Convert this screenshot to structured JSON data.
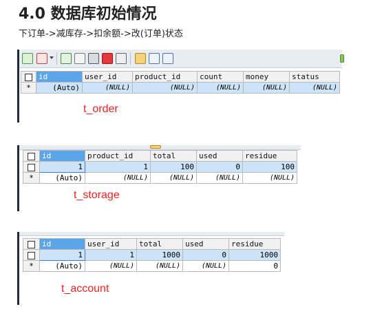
{
  "heading": "4.0 数据库初始情况",
  "description": "下订单->减库存->扣余额->改(订单)状态",
  "colors": {
    "selected_header": "#5aa6e8",
    "row_highlight": "#cde3f8",
    "label_red": "#ee2222",
    "panel_border": "#1f2a3c"
  },
  "toolbar_icons": [
    "add-record-icon",
    "delete-record-icon",
    "dropdown-icon",
    "insert-icon",
    "copy-icon",
    "save-icon",
    "trash-icon",
    "cancel-icon",
    "grid-view-icon",
    "form-view-icon",
    "text-view-icon",
    "partial-icon"
  ],
  "t_order": {
    "label": "t_order",
    "columns": [
      "id",
      "user_id",
      "product_id",
      "count",
      "money",
      "status"
    ],
    "rows": [
      {
        "indicator": "*",
        "cells": [
          "(Auto)",
          "(NULL)",
          "(NULL)",
          "(NULL)",
          "(NULL)",
          "(NULL)"
        ]
      }
    ]
  },
  "t_storage": {
    "label": "t_storage",
    "columns": [
      "id",
      "product_id",
      "total",
      "used",
      "residue"
    ],
    "rows": [
      {
        "indicator": "",
        "cells": [
          "1",
          "1",
          "100",
          "0",
          "100"
        ]
      },
      {
        "indicator": "*",
        "cells": [
          "(Auto)",
          "(NULL)",
          "(NULL)",
          "(NULL)",
          "(NULL)"
        ]
      }
    ]
  },
  "t_account": {
    "label": "t_account",
    "columns": [
      "id",
      "user_id",
      "total",
      "used",
      "residue"
    ],
    "rows": [
      {
        "indicator": "",
        "cells": [
          "1",
          "1",
          "1000",
          "0",
          "1000"
        ]
      },
      {
        "indicator": "*",
        "cells": [
          "(Auto)",
          "(NULL)",
          "(NULL)",
          "(NULL)",
          "0"
        ]
      }
    ]
  }
}
